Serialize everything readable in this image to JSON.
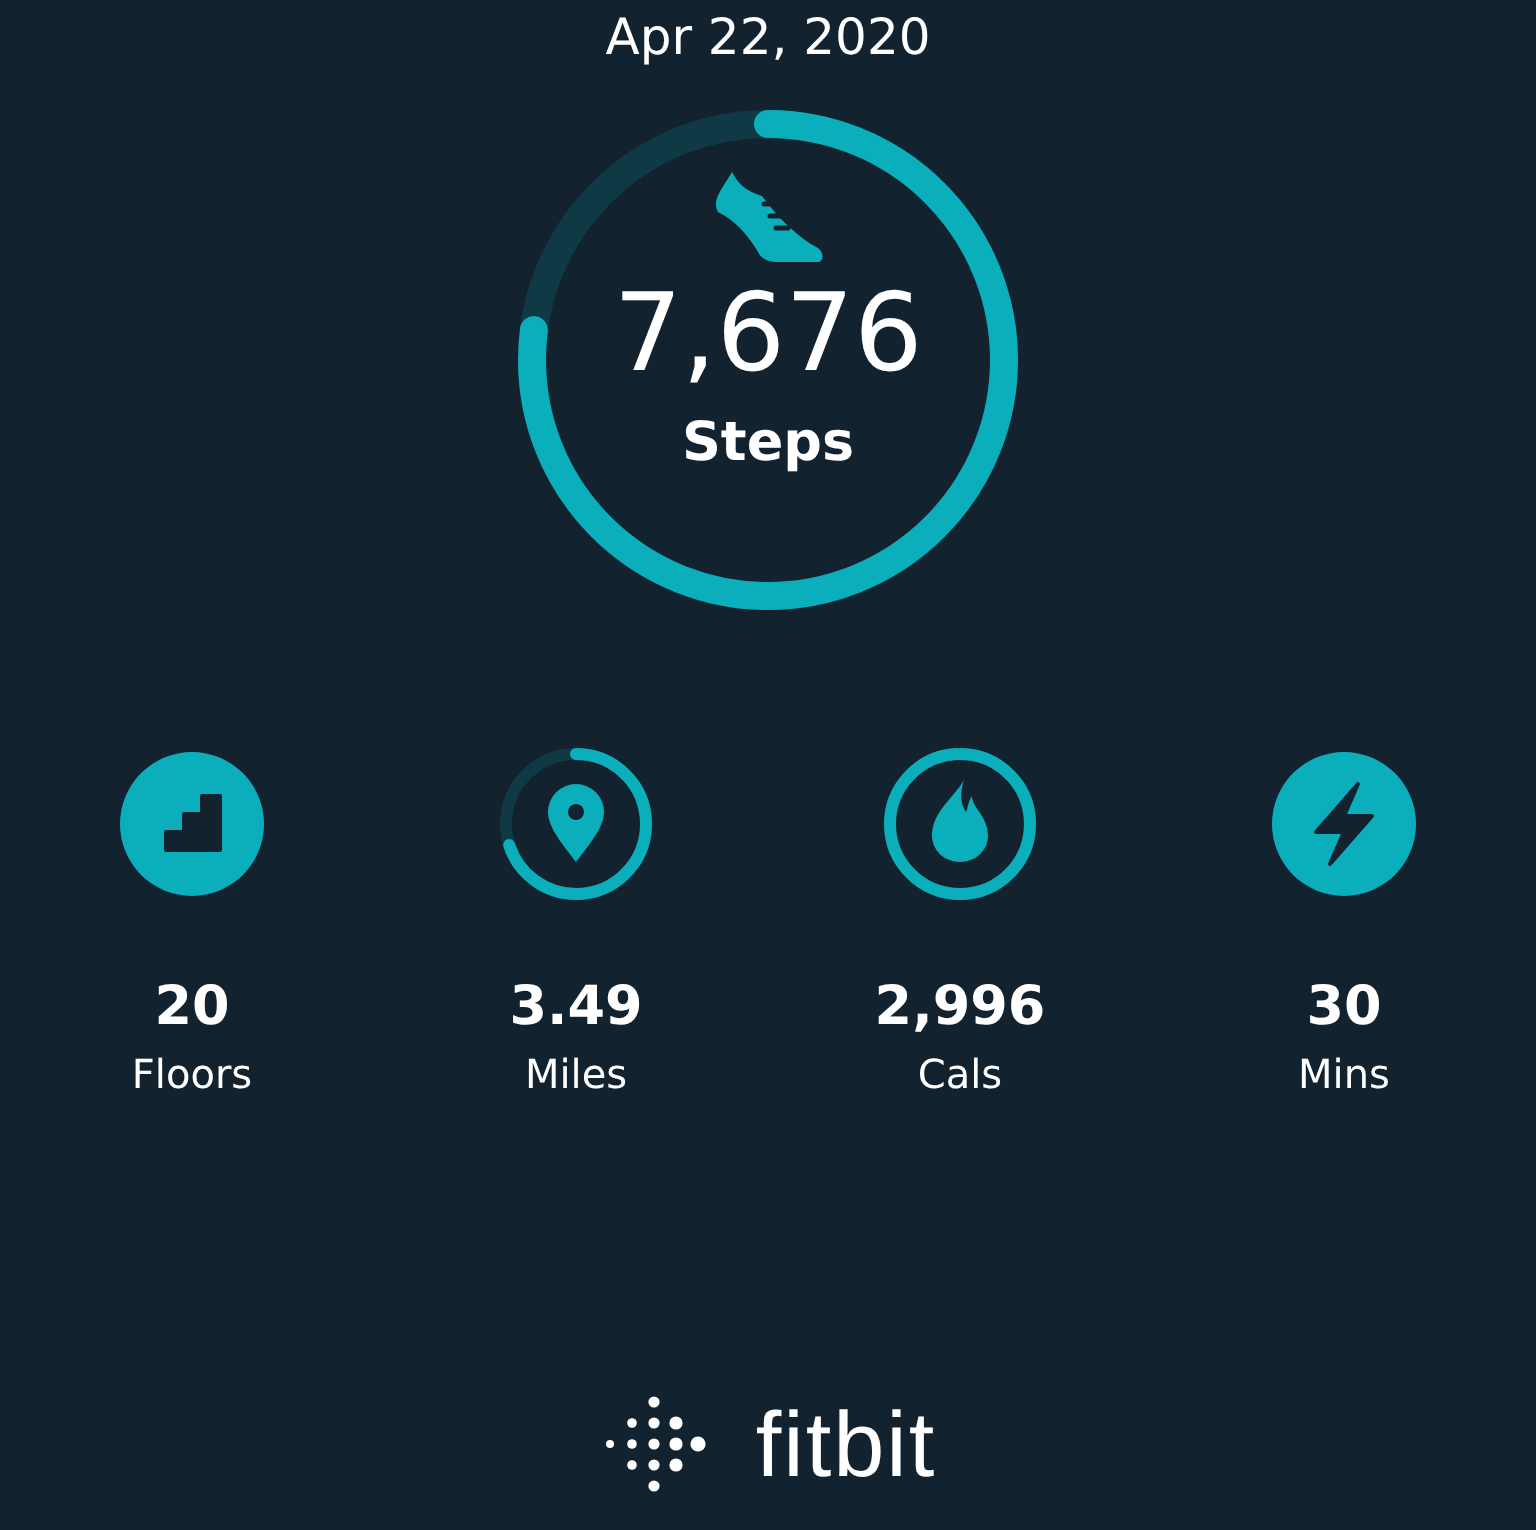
{
  "date": "Apr 22, 2020",
  "steps": {
    "value": "7,676",
    "label": "Steps"
  },
  "stats": [
    {
      "kind": "floors",
      "value": "20",
      "label": "Floors",
      "goal_met": true
    },
    {
      "kind": "miles",
      "value": "3.49",
      "label": "Miles",
      "goal_met": false
    },
    {
      "kind": "cals",
      "value": "2,996",
      "label": "Cals",
      "goal_met": false
    },
    {
      "kind": "mins",
      "value": "30",
      "label": "Mins",
      "goal_met": true
    }
  ],
  "brand": "fitbit"
}
